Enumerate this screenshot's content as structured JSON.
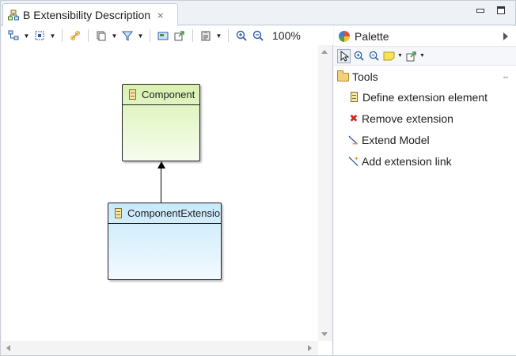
{
  "editor": {
    "tab_title": "B Extensibility Description",
    "close_glyph": "⨯"
  },
  "toolbar": {
    "zoom": "100%"
  },
  "diagram": {
    "nodes": [
      {
        "label": "Component"
      },
      {
        "label": "ComponentExtension"
      }
    ]
  },
  "palette": {
    "title": "Palette",
    "drawer": {
      "label": "Tools",
      "tools": [
        {
          "label": "Define extension element",
          "icon": "extension-element-icon"
        },
        {
          "label": "Remove extension",
          "icon": "remove-icon"
        },
        {
          "label": "Extend Model",
          "icon": "extend-model-icon"
        },
        {
          "label": "Add extension link",
          "icon": "extension-link-icon"
        }
      ]
    }
  },
  "colors": {
    "component_fill_top": "#d8f2b0",
    "extension_fill_top": "#c8e9fb",
    "remove_icon": "#d7261e",
    "accent": "#2a5da8"
  }
}
